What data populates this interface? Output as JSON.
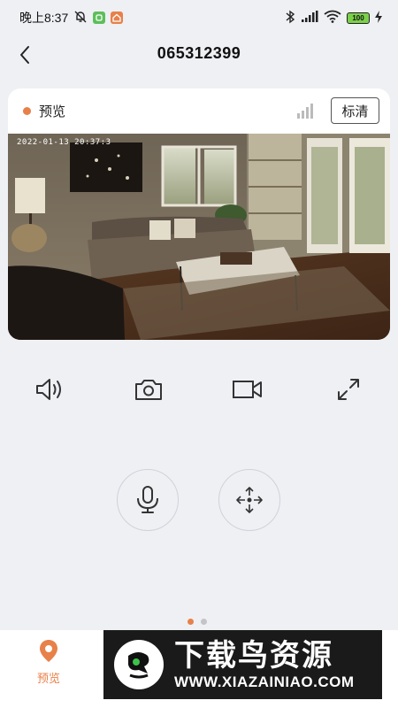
{
  "status_bar": {
    "time": "晚上8:37",
    "battery": "100"
  },
  "header": {
    "title": "065312399"
  },
  "camera_card": {
    "label": "预览",
    "quality": "标清",
    "timestamp": "2022-01-13 20:37:3"
  },
  "bottom_nav": {
    "preview_label": "预览"
  },
  "watermark": {
    "title": "下载鸟资源",
    "url": "WWW.XIAZAINIAO.COM"
  },
  "colors": {
    "accent": "#e8804a",
    "background": "#eef0f4"
  },
  "pager": {
    "count": 2,
    "active_index": 0
  }
}
